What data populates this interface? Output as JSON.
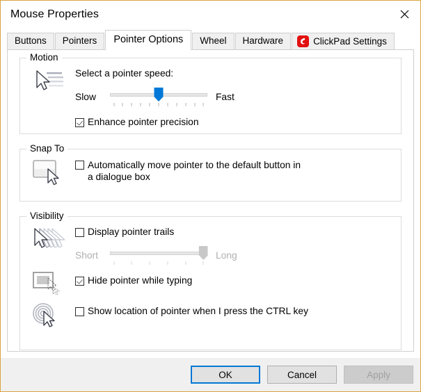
{
  "window": {
    "title": "Mouse Properties",
    "close_icon": "close-icon",
    "border_color": "#d9a441",
    "accent_color": "#0078d7"
  },
  "tabs": [
    {
      "label": "Buttons",
      "active": false
    },
    {
      "label": "Pointers",
      "active": false
    },
    {
      "label": "Pointer Options",
      "active": true
    },
    {
      "label": "Wheel",
      "active": false
    },
    {
      "label": "Hardware",
      "active": false
    },
    {
      "label": "ClickPad Settings",
      "active": false,
      "icon": "clickpad-flame-icon",
      "icon_color": "#e31010"
    }
  ],
  "groups": {
    "motion": {
      "title": "Motion",
      "glyph": "pointer-speed-icon",
      "speed_label": "Select a pointer speed:",
      "slider": {
        "left_label": "Slow",
        "right_label": "Fast",
        "value": 6,
        "min": 1,
        "max": 11,
        "ticks": 11,
        "enabled": true
      },
      "enhance_precision": {
        "label": "Enhance pointer precision",
        "checked": true
      }
    },
    "snapto": {
      "title": "Snap To",
      "glyph": "snap-to-button-icon",
      "auto_move": {
        "label": "Automatically move pointer to the default button in a dialogue box",
        "checked": false
      }
    },
    "visibility": {
      "title": "Visibility",
      "trails_glyph": "pointer-trails-icon",
      "display_trails": {
        "label": "Display pointer trails",
        "checked": false
      },
      "trails_slider": {
        "left_label": "Short",
        "right_label": "Long",
        "value": 6,
        "min": 1,
        "max": 6,
        "ticks": 6,
        "enabled": false
      },
      "hide_typing_glyph": "hide-pointer-typing-icon",
      "hide_while_typing": {
        "label": "Hide pointer while typing",
        "checked": true
      },
      "ctrl_locate_glyph": "locate-pointer-icon",
      "show_location": {
        "label": "Show location of pointer when I press the CTRL key",
        "checked": false
      }
    }
  },
  "footer": {
    "ok_label": "OK",
    "cancel_label": "Cancel",
    "apply_label": "Apply",
    "apply_enabled": false
  }
}
